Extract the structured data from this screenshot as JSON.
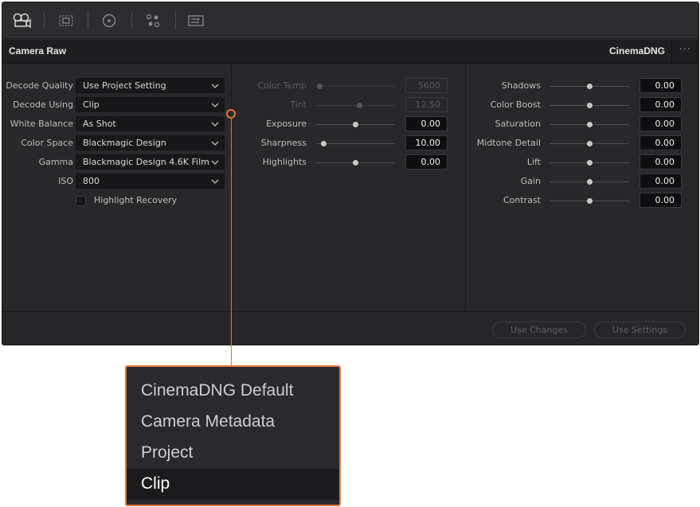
{
  "toolbar": {
    "icons": [
      "camera-raw-icon",
      "lut-icon",
      "color-wheels-icon",
      "nodes-icon",
      "settings-icon"
    ]
  },
  "panel": {
    "title": "Camera Raw",
    "mode": "CinemaDNG",
    "menu": "···"
  },
  "decode": {
    "fields": [
      {
        "label": "Decode Quality",
        "value": "Use Project Setting"
      },
      {
        "label": "Decode Using",
        "value": "Clip"
      },
      {
        "label": "White Balance",
        "value": "As Shot"
      },
      {
        "label": "Color Space",
        "value": "Blackmagic Design"
      },
      {
        "label": "Gamma",
        "value": "Blackmagic Design 4.6K Film"
      },
      {
        "label": "ISO",
        "value": "800"
      }
    ],
    "highlight_recovery": {
      "label": "Highlight Recovery",
      "checked": false
    }
  },
  "sliders_mid": [
    {
      "label": "Color Temp",
      "value": "5600",
      "level": 0.05,
      "enabled": false
    },
    {
      "label": "Tint",
      "value": "12.50",
      "level": 0.55,
      "enabled": false
    },
    {
      "label": "Exposure",
      "value": "0.00",
      "level": 0.5,
      "enabled": true
    },
    {
      "label": "Sharpness",
      "value": "10.00",
      "level": 0.1,
      "enabled": true
    },
    {
      "label": "Highlights",
      "value": "0.00",
      "level": 0.5,
      "enabled": true
    }
  ],
  "sliders_right": [
    {
      "label": "Shadows",
      "value": "0.00",
      "level": 0.5
    },
    {
      "label": "Color Boost",
      "value": "0.00",
      "level": 0.5
    },
    {
      "label": "Saturation",
      "value": "0.00",
      "level": 0.5
    },
    {
      "label": "Midtone Detail",
      "value": "0.00",
      "level": 0.5
    },
    {
      "label": "Lift",
      "value": "0.00",
      "level": 0.5
    },
    {
      "label": "Gain",
      "value": "0.00",
      "level": 0.5
    },
    {
      "label": "Contrast",
      "value": "0.00",
      "level": 0.5
    }
  ],
  "footer": {
    "use_changes": "Use Changes",
    "use_settings": "Use Settings"
  },
  "decode_using_menu": {
    "options": [
      "CinemaDNG Default",
      "Camera Metadata",
      "Project",
      "Clip"
    ],
    "selected": "Clip"
  },
  "colors": {
    "accent": "#e0763a",
    "panel_bg": "#28282b"
  }
}
